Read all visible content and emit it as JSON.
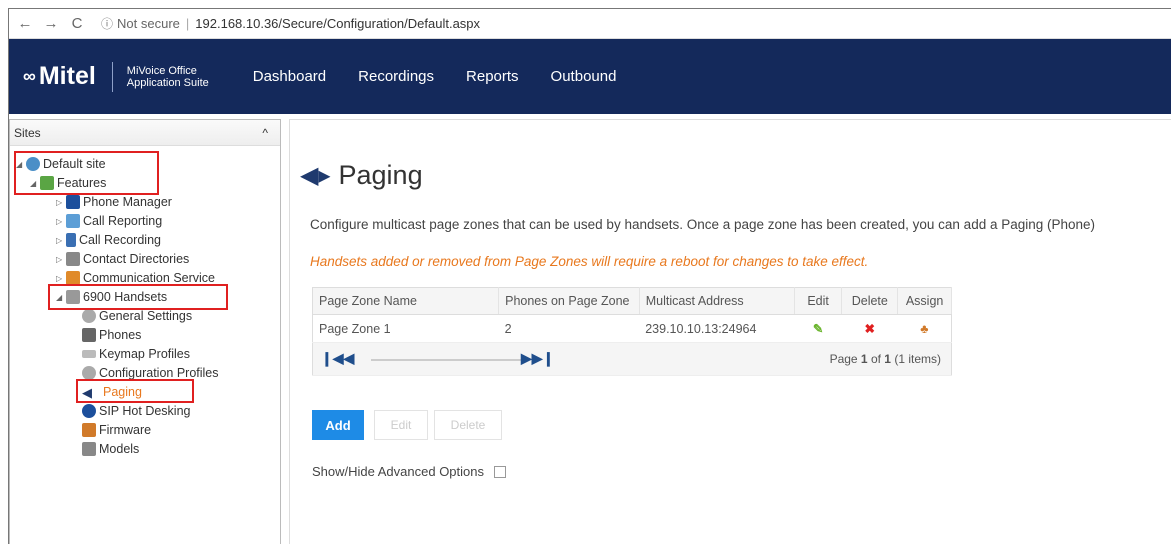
{
  "browser": {
    "back": "←",
    "forward": "→",
    "reload": "C",
    "info_icon": "ⓘ",
    "security": "Not secure",
    "url": "192.168.10.36/Secure/Configuration/Default.aspx"
  },
  "header": {
    "brand": "Mitel",
    "suite_line1": "MiVoice Office",
    "suite_line2": "Application Suite",
    "nav": [
      "Dashboard",
      "Recordings",
      "Reports",
      "Outbound"
    ],
    "color": "#14295b"
  },
  "sidebar": {
    "title": "Sites",
    "collapse": "^",
    "items": [
      {
        "label": "Default site",
        "icon": "globe-icon"
      },
      {
        "label": "Features",
        "icon": "features-icon"
      },
      {
        "label": "Phone Manager",
        "icon": "phone-manager-icon"
      },
      {
        "label": "Call Reporting",
        "icon": "chart-icon"
      },
      {
        "label": "Call Recording",
        "icon": "waveform-icon"
      },
      {
        "label": "Contact Directories",
        "icon": "directory-icon"
      },
      {
        "label": "Communication Service",
        "icon": "people-icon"
      },
      {
        "label": "6900 Handsets",
        "icon": "handset-icon"
      },
      {
        "label": "General Settings",
        "icon": "gear-icon"
      },
      {
        "label": "Phones",
        "icon": "phone-icon"
      },
      {
        "label": "Keymap Profiles",
        "icon": "key-icon"
      },
      {
        "label": "Configuration Profiles",
        "icon": "gear-icon"
      },
      {
        "label": "Paging",
        "icon": "megaphone-icon"
      },
      {
        "label": "SIP Hot Desking",
        "icon": "desk-icon"
      },
      {
        "label": "Firmware",
        "icon": "firmware-icon"
      },
      {
        "label": "Models",
        "icon": "models-icon"
      }
    ]
  },
  "page": {
    "title": "Paging",
    "description": "Configure multicast page zones that can be used by handsets. Once a page zone has been created, you can add a Paging (Phone)",
    "warning": "Handsets added or removed from Page Zones will require a reboot for changes to take effect.",
    "table": {
      "headers": [
        "Page Zone Name",
        "Phones on Page Zone",
        "Multicast Address",
        "Edit",
        "Delete",
        "Assign"
      ],
      "rows": [
        {
          "name": "Page Zone 1",
          "phones": "2",
          "address": "239.10.10.13:24964",
          "edit_icon": "pencil-icon",
          "delete_icon": "x-icon",
          "assign_icon": "assign-icon"
        }
      ],
      "pager": {
        "first": "◀",
        "next": "▶",
        "text_page": "Page ",
        "current": "1",
        "text_of": " of ",
        "total": "1",
        "items": " (1 items)"
      }
    },
    "buttons": {
      "add": "Add",
      "edit": "Edit",
      "delete": "Delete"
    },
    "advanced": "Show/Hide Advanced Options"
  }
}
